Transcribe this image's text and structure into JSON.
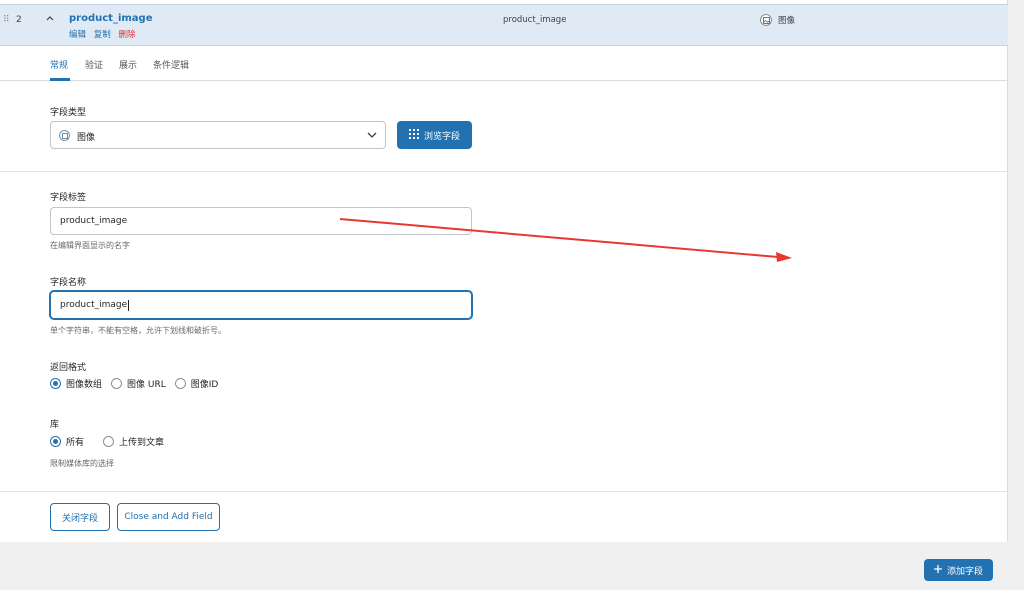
{
  "header": {
    "order": "2",
    "field_label": "product_image",
    "actions": {
      "edit": "编辑",
      "duplicate": "复制",
      "delete": "删除"
    },
    "field_name": "product_image",
    "field_type": "图像"
  },
  "tabs": [
    {
      "label": "常规",
      "active": true
    },
    {
      "label": "验证",
      "active": false
    },
    {
      "label": "展示",
      "active": false
    },
    {
      "label": "条件逻辑",
      "active": false
    }
  ],
  "field_type": {
    "label": "字段类型",
    "selected": "图像",
    "browse_button": "浏览字段"
  },
  "field_label": {
    "label": "字段标签",
    "value": "product_image",
    "help": "在编辑界面显示的名字"
  },
  "field_name": {
    "label": "字段名称",
    "value": "product_image",
    "help": "单个字符串，不能有空格，允许下划线和破折号。"
  },
  "return_format": {
    "label": "返回格式",
    "options": [
      "图像数组",
      "图像 URL",
      "图像ID"
    ],
    "selected": "图像数组"
  },
  "library": {
    "label": "库",
    "options": [
      "所有",
      "上传到文章"
    ],
    "selected": "所有",
    "help": "限制媒体库的选择"
  },
  "footer": {
    "close_button": "关闭字段",
    "close_add_button": "Close and Add Field"
  },
  "add_field_button": "添加字段",
  "colors": {
    "accent": "#2271b1",
    "danger": "#d63638",
    "annotation": "#e8382f"
  }
}
